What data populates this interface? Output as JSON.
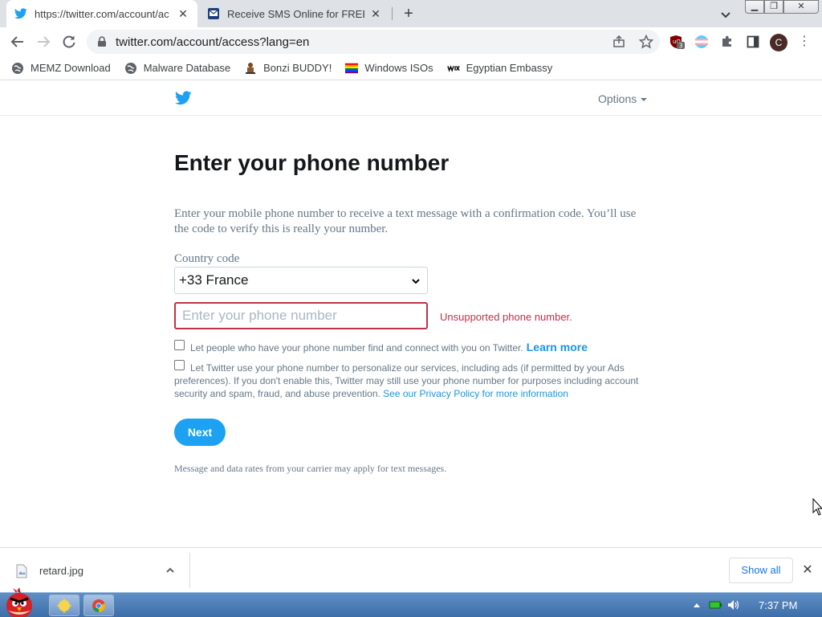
{
  "browser": {
    "tabs": [
      {
        "title": "https://twitter.com/account/ac",
        "active": true,
        "favicon": "twitter-bird-icon"
      },
      {
        "title": "Receive SMS Online for FREE |",
        "active": false,
        "favicon": "sms-site-icon"
      }
    ],
    "url": "twitter.com/account/access?lang=en",
    "extension_badge": "3",
    "profile_initial": "C",
    "bookmarks": [
      {
        "label": "MEMZ Download",
        "icon": "globe-icon"
      },
      {
        "label": "Malware Database",
        "icon": "globe-icon"
      },
      {
        "label": "Bonzi BUDDY!",
        "icon": "bonzi-icon"
      },
      {
        "label": "Windows ISOs",
        "icon": "rainbow-flag-icon"
      },
      {
        "label": "Egyptian Embassy",
        "icon": "wix-icon"
      }
    ]
  },
  "twitter": {
    "options_label": "Options",
    "title": "Enter your phone number",
    "description": "Enter your mobile phone number to receive a text message with a confirmation code. You’ll use the code to verify this is really your number.",
    "country_label": "Country code",
    "country_value": "+33 France",
    "phone_placeholder": "Enter your phone number",
    "error": "Unsupported phone number.",
    "checkbox1_text": "Let people who have your phone number find and connect with you on Twitter.",
    "learn_more": "Learn more",
    "checkbox2_text": "Let Twitter use your phone number to personalize our services, including ads (if permitted by your Ads preferences). If you don't enable this, Twitter may still use your phone number for purposes including account security and spam, fraud, and abuse prevention.",
    "privacy_link": "See our Privacy Policy for more information",
    "next_label": "Next",
    "rates_note": "Message and data rates from your carrier may apply for text messages."
  },
  "downloads": {
    "file_name": "retard.jpg",
    "show_all": "Show all"
  },
  "taskbar": {
    "clock": "7:37 PM"
  },
  "colors": {
    "twitter_blue": "#1da1f2",
    "error_red": "#c03249",
    "link_blue": "#1b95e0"
  }
}
